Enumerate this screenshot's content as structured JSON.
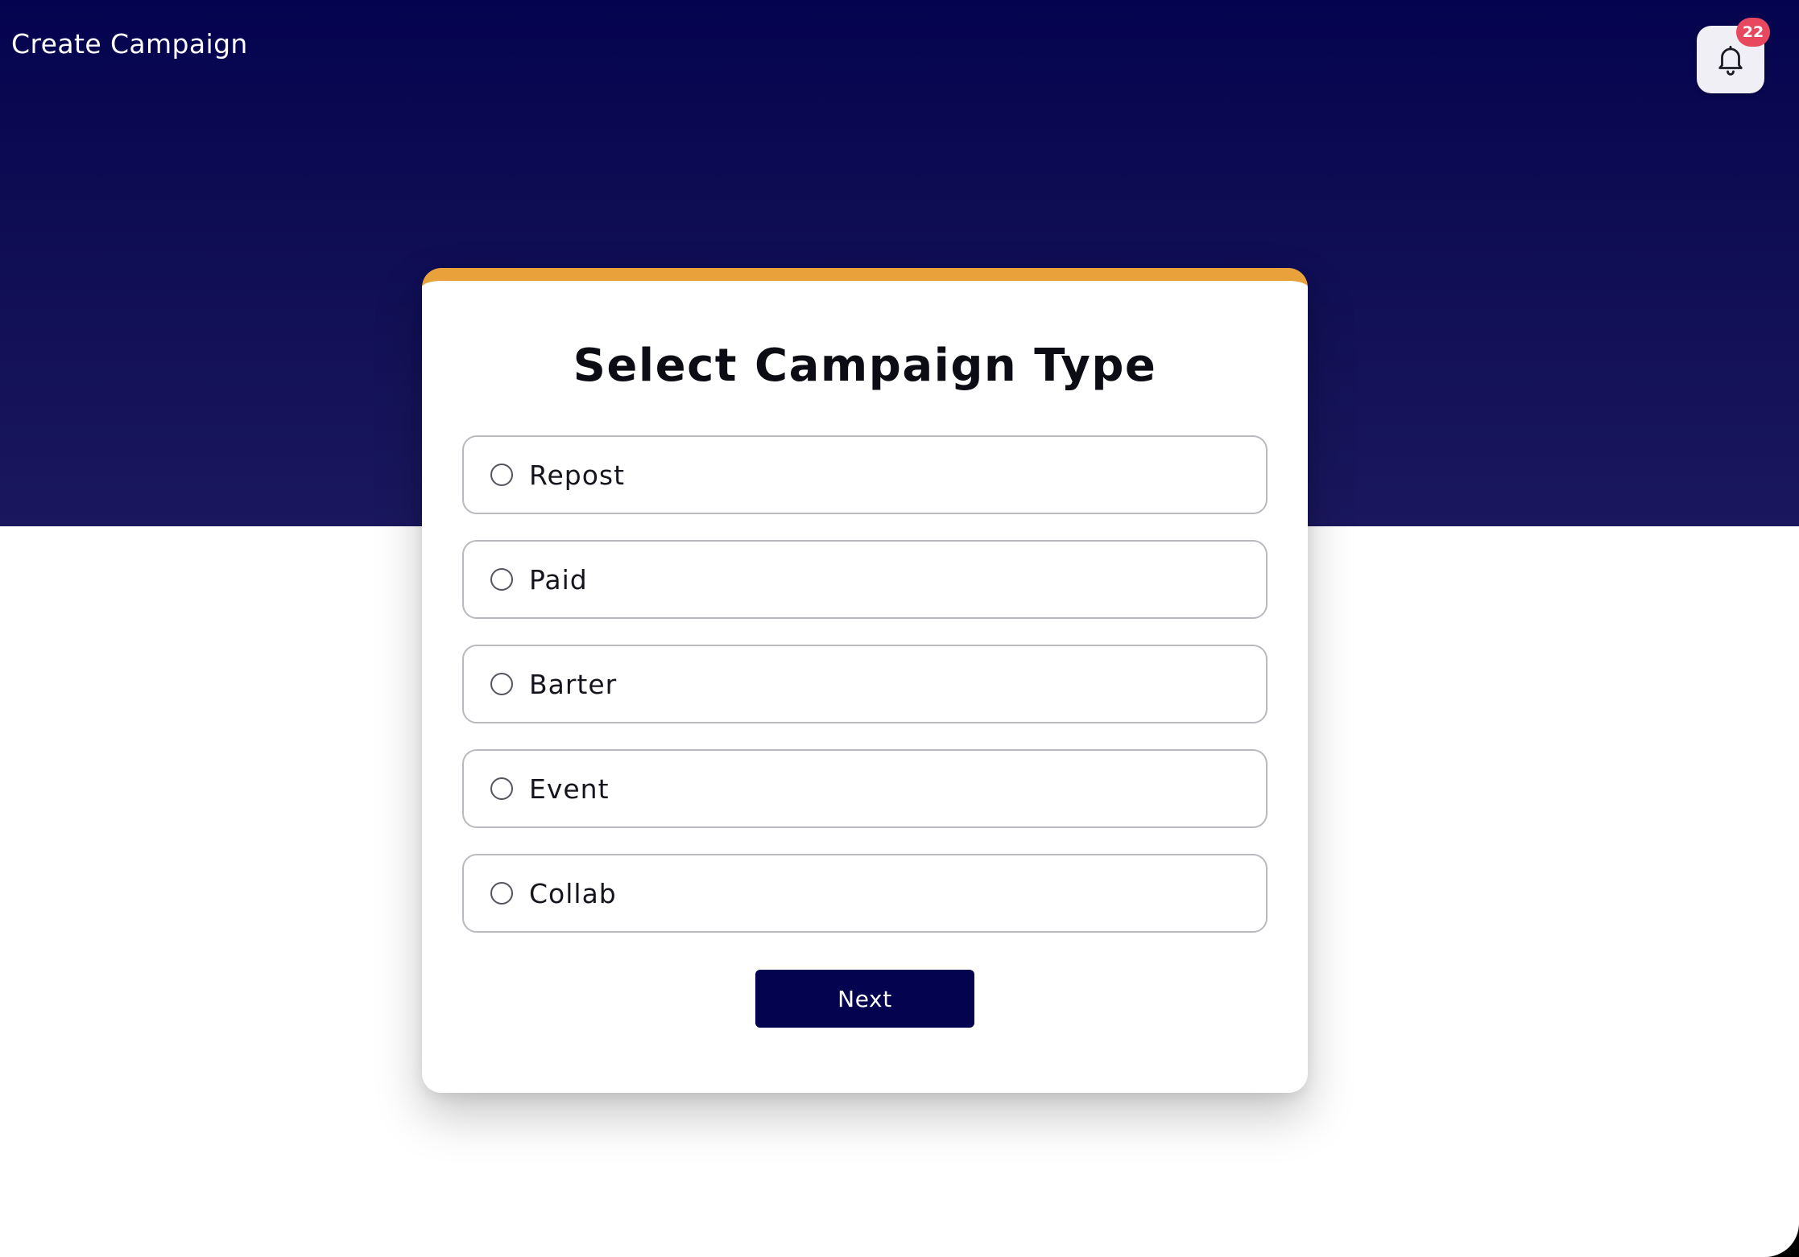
{
  "header": {
    "title": "Create Campaign",
    "notifications": {
      "icon": "bell-icon",
      "count": "22"
    }
  },
  "card": {
    "title": "Select Campaign Type",
    "options": [
      {
        "label": "Repost",
        "selected": false
      },
      {
        "label": "Paid",
        "selected": false
      },
      {
        "label": "Barter",
        "selected": false
      },
      {
        "label": "Event",
        "selected": false
      },
      {
        "label": "Collab",
        "selected": false
      }
    ],
    "next_label": "Next"
  },
  "colors": {
    "header_bg_top": "#04034f",
    "header_bg_bottom": "#1a175e",
    "card_accent": "#e9a23b",
    "badge": "#e8485e",
    "primary_button": "#04034f"
  }
}
